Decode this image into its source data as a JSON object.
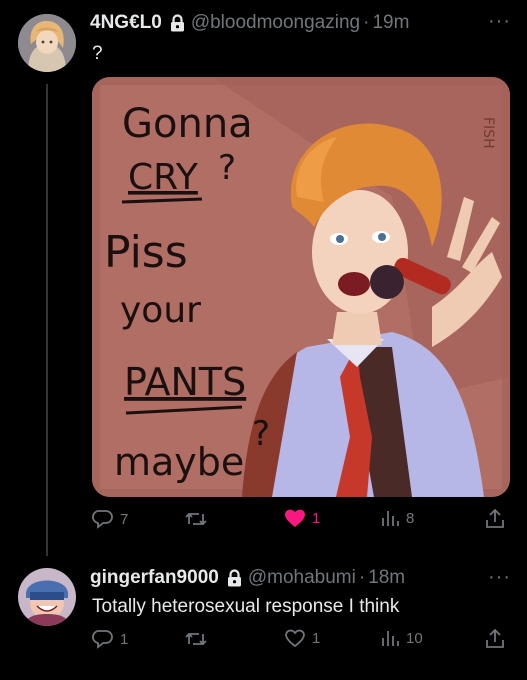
{
  "tweet1": {
    "display_name": "4NG€L0",
    "handle": "@bloodmoongazing",
    "time": "19m",
    "text": "?",
    "artwork": {
      "lines": [
        "Gonna",
        "CRY",
        "?",
        "Piss",
        "your",
        "PANTS",
        "maybe",
        "?"
      ],
      "signature": "FISH"
    },
    "actions": {
      "replies": "7",
      "retweets": "",
      "likes": "1",
      "views": "8"
    }
  },
  "tweet2": {
    "display_name": "gingerfan9000",
    "handle": "@mohabumi",
    "time": "18m",
    "text": "Totally heterosexual response I think",
    "actions": {
      "replies": "1",
      "retweets": "",
      "likes": "1",
      "views": "10"
    }
  },
  "colors": {
    "like_active": "#f91880",
    "muted": "#71767b",
    "thread_line": "#333639"
  },
  "icons": [
    "lock-icon",
    "more-icon",
    "reply-icon",
    "retweet-icon",
    "like-icon",
    "views-icon",
    "share-icon"
  ]
}
